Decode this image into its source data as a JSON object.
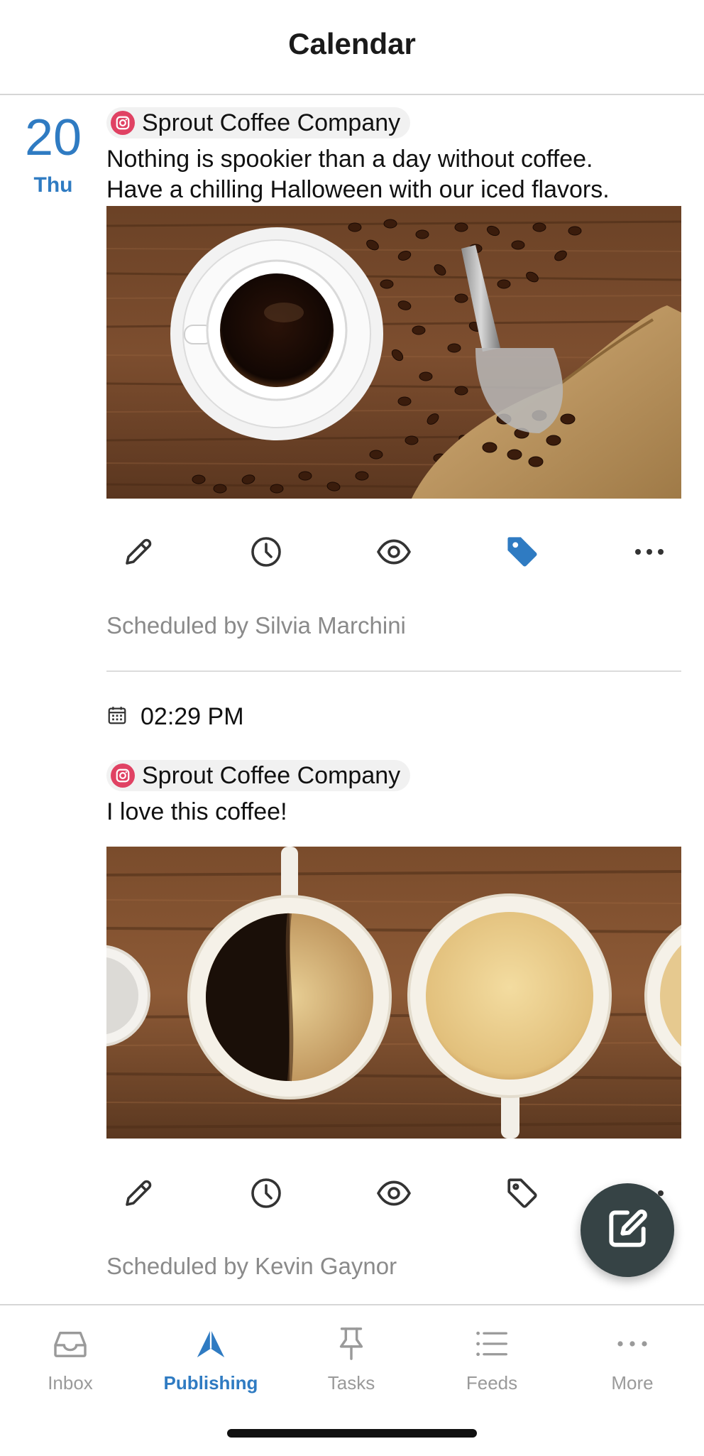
{
  "header": {
    "title": "Calendar"
  },
  "date": {
    "day_number": "20",
    "weekday": "Thu"
  },
  "posts": [
    {
      "account": "Sprout Coffee Company",
      "network_icon": "instagram-icon",
      "text_lines": [
        "Nothing is spookier than a day without coffee.",
        "Have a chilling Halloween with our iced flavors."
      ],
      "image": "cup of coffee with coffee beans, scoop and burlap sack on wooden table",
      "actions": [
        "edit-icon",
        "clock-icon",
        "eye-icon",
        "tag-icon",
        "more-icon"
      ],
      "tag_active": true,
      "scheduled_by": "Scheduled by Silvia Marchini"
    },
    {
      "time": "02:29 PM",
      "account": "Sprout Coffee Company",
      "network_icon": "instagram-icon",
      "text_lines": [
        "I love this coffee!"
      ],
      "image": "row of coffee cups viewed from above on wooden table",
      "actions": [
        "edit-icon",
        "clock-icon",
        "eye-icon",
        "tag-icon",
        "more-icon"
      ],
      "tag_active": false,
      "scheduled_by": "Scheduled by Kevin Gaynor"
    }
  ],
  "fab": {
    "icon": "compose-icon"
  },
  "tabs": [
    {
      "label": "Inbox",
      "icon": "inbox-icon",
      "active": false
    },
    {
      "label": "Publishing",
      "icon": "publishing-icon",
      "active": true
    },
    {
      "label": "Tasks",
      "icon": "pin-icon",
      "active": false
    },
    {
      "label": "Feeds",
      "icon": "list-icon",
      "active": false
    },
    {
      "label": "More",
      "icon": "more-icon",
      "active": false
    }
  ],
  "colors": {
    "accent": "#2f7bc2",
    "instagram": "#e04263",
    "fab": "#364345",
    "muted": "#8a8a8a"
  }
}
